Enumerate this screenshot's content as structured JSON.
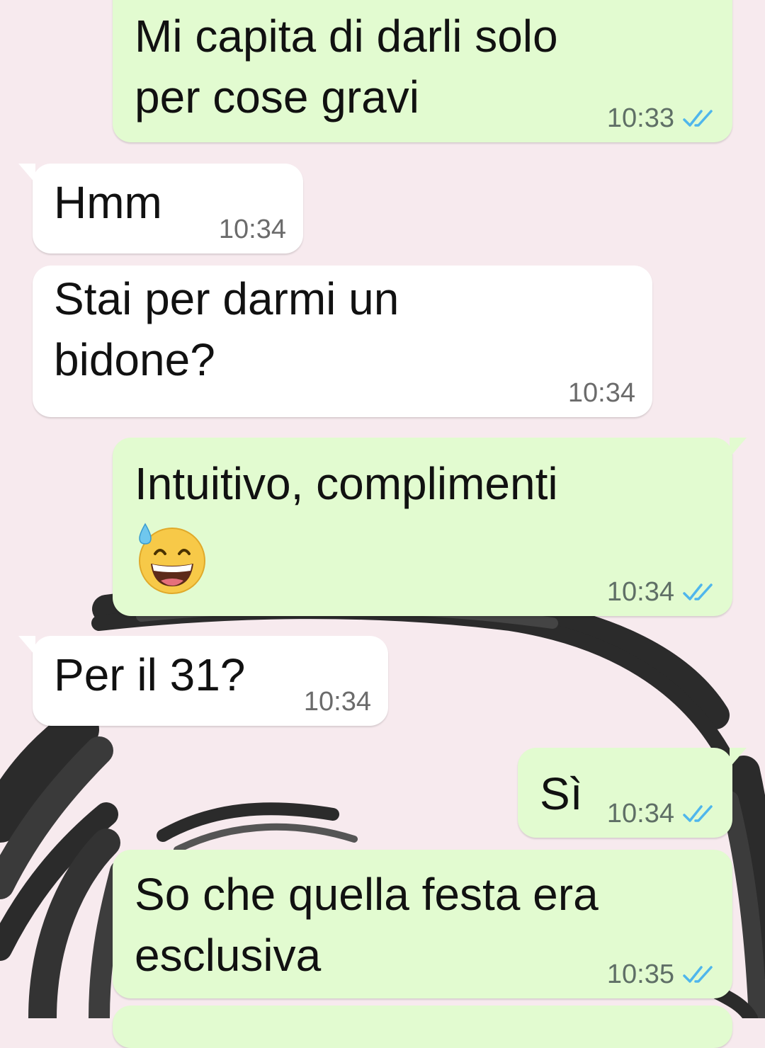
{
  "colors": {
    "outgoing_bubble": "#e2fbd0",
    "incoming_bubble": "#ffffff",
    "read_ticks": "#4fb6ec",
    "wallpaper": "#f7eaee"
  },
  "messages": [
    {
      "direction": "outgoing",
      "text": "Mi capita di darli solo\nper cose gravi",
      "time": "10:33",
      "status": "read"
    },
    {
      "direction": "incoming",
      "text": "Hmm",
      "time": "10:34"
    },
    {
      "direction": "incoming",
      "text": "Stai per darmi un\nbidone?",
      "time": "10:34"
    },
    {
      "direction": "outgoing",
      "text": "Intuitivo, complimenti",
      "emoji": "grinning-face-with-sweat-icon",
      "time": "10:34",
      "status": "read"
    },
    {
      "direction": "incoming",
      "text": "Per il 31?",
      "time": "10:34"
    },
    {
      "direction": "outgoing",
      "text": "Sì",
      "time": "10:34",
      "status": "read"
    },
    {
      "direction": "outgoing",
      "text": "So che quella festa era\nesclusiva",
      "time": "10:35",
      "status": "read"
    }
  ]
}
